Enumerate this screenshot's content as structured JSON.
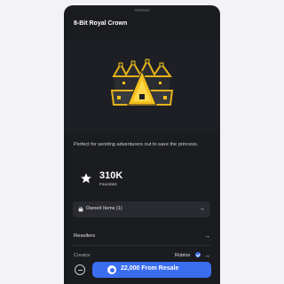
{
  "item": {
    "title": "8-Bit Royal Crown",
    "description": "Perfect for sending adventurers out to save the princess."
  },
  "stats": {
    "favorites_count": "310K",
    "favorites_label": "Favorites"
  },
  "owned": {
    "label": "Owned Items (1)",
    "arrow": "→"
  },
  "resellers": {
    "label": "Resellers",
    "arrow": "→"
  },
  "creator": {
    "label": "Creator",
    "name": "Roblox",
    "arrow": "→"
  },
  "purchase": {
    "button_label": "22,000 From Resale"
  },
  "colors": {
    "panel_bg": "#1b1c20",
    "accent": "#3a6df0"
  }
}
